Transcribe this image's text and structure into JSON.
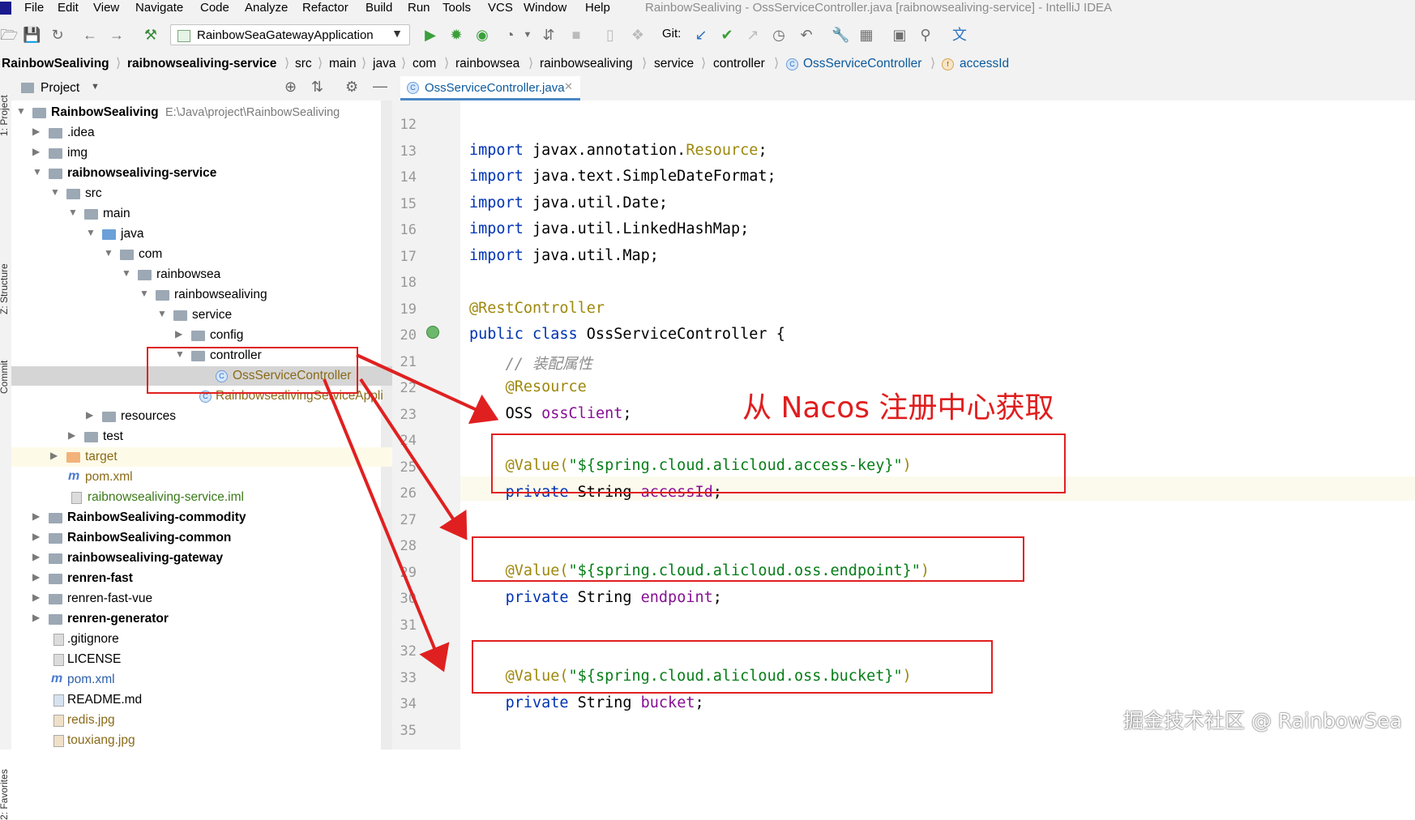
{
  "menu": [
    "File",
    "Edit",
    "View",
    "Navigate",
    "Code",
    "Analyze",
    "Refactor",
    "Build",
    "Run",
    "Tools",
    "VCS",
    "Window",
    "Help"
  ],
  "window_title": "RainbowSealiving - OssServiceController.java [raibnowsealiving-service] - IntelliJ IDEA",
  "toolbar": {
    "run_config": "RainbowSeaGatewayApplication",
    "git_label": "Git:"
  },
  "breadcrumb": [
    "RainbowSealiving",
    "raibnowsealiving-service",
    "src",
    "main",
    "java",
    "com",
    "rainbowsea",
    "rainbowsealiving",
    "service",
    "controller",
    "OssServiceController",
    "accessId"
  ],
  "side_tabs": {
    "project": "1: Project",
    "structure": "Z: Structure",
    "commit": "Commit",
    "favorites": "2: Favorites"
  },
  "project_panel": {
    "title": "Project",
    "tree": [
      {
        "label": "RainbowSealiving",
        "path": "E:\\Java\\project\\RainbowSealiving"
      },
      {
        "label": ".idea"
      },
      {
        "label": "img"
      },
      {
        "label": "raibnowsealiving-service"
      },
      {
        "label": "src"
      },
      {
        "label": "main"
      },
      {
        "label": "java"
      },
      {
        "label": "com"
      },
      {
        "label": "rainbowsea"
      },
      {
        "label": "rainbowsealiving"
      },
      {
        "label": "service"
      },
      {
        "label": "config"
      },
      {
        "label": "controller"
      },
      {
        "label": "OssServiceController"
      },
      {
        "label": "RainbowsealivingServiceAppli"
      },
      {
        "label": "resources"
      },
      {
        "label": "test"
      },
      {
        "label": "target"
      },
      {
        "label": "pom.xml"
      },
      {
        "label": "raibnowsealiving-service.iml"
      },
      {
        "label": "RainbowSealiving-commodity"
      },
      {
        "label": "RainbowSealiving-common"
      },
      {
        "label": "rainbowsealiving-gateway"
      },
      {
        "label": "renren-fast"
      },
      {
        "label": "renren-fast-vue"
      },
      {
        "label": "renren-generator"
      },
      {
        "label": ".gitignore"
      },
      {
        "label": "LICENSE"
      },
      {
        "label": "pom.xml"
      },
      {
        "label": "README.md"
      },
      {
        "label": "redis.jpg"
      },
      {
        "label": "touxiang.jpg"
      }
    ]
  },
  "editor": {
    "tab_label": "OssServiceController.java",
    "line_numbers": [
      "12",
      "13",
      "14",
      "15",
      "16",
      "17",
      "18",
      "19",
      "20",
      "21",
      "22",
      "23",
      "24",
      "25",
      "26",
      "27",
      "28",
      "29",
      "30",
      "31",
      "32",
      "33",
      "34",
      "35"
    ],
    "code": {
      "l13": {
        "kw": "import",
        "pkg": "javax.annotation.",
        "cls": "Resource",
        "end": ";"
      },
      "l14": {
        "kw": "import",
        "rest": "java.text.SimpleDateFormat;"
      },
      "l15": {
        "kw": "import",
        "rest": "java.util.Date;"
      },
      "l16": {
        "kw": "import",
        "rest": "java.util.LinkedHashMap;"
      },
      "l17": {
        "kw": "import",
        "rest": "java.util.Map;"
      },
      "l19": {
        "ann": "@RestController"
      },
      "l20": {
        "kw": "public class",
        "rest": "OssServiceController {"
      },
      "l21": {
        "cmt": "// 装配属性"
      },
      "l22": {
        "ann": "@Resource"
      },
      "l23": {
        "type": "OSS",
        "fld": "ossClient",
        "end": ";"
      },
      "l25": {
        "ann": "@Value(",
        "str": "\"${spring.cloud.alicloud.access-key}\"",
        "end": ")"
      },
      "l26": {
        "kw": "private",
        "type": "String",
        "fld": "accessId",
        "end": ";"
      },
      "l29": {
        "ann": "@Value(",
        "str": "\"${spring.cloud.alicloud.oss.endpoint}\"",
        "end": ")"
      },
      "l30": {
        "kw": "private",
        "type": "String",
        "fld": "endpoint",
        "end": ";"
      },
      "l33": {
        "ann": "@Value(",
        "str": "\"${spring.cloud.alicloud.oss.bucket}\"",
        "end": ")"
      },
      "l34": {
        "kw": "private",
        "type": "String",
        "fld": "bucket",
        "end": ";"
      }
    }
  },
  "annotation_callout": "从 Nacos 注册中心获取",
  "watermark": "掘金技术社区 @ RainbowSea",
  "colors": {
    "annotation_red": "#e02020",
    "keyword": "#0033b3",
    "string": "#067d17",
    "field": "#871094",
    "annotation": "#9e880d"
  }
}
